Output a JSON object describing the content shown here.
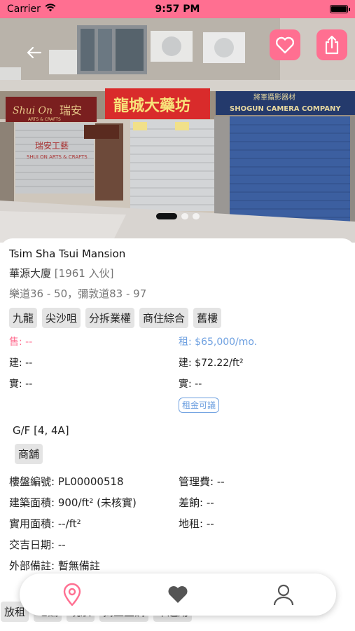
{
  "status_bar": {
    "carrier": "Carrier",
    "time": "9:57 PM"
  },
  "colors": {
    "accent": "#ff6f91",
    "rent_blue": "#6ea0e0",
    "tag_bg": "#e4e4e4"
  },
  "header": {
    "back_icon": "back-arrow-icon",
    "favorite_icon": "heart-outline-icon",
    "share_icon": "share-icon",
    "carousel_pages": 3,
    "carousel_active": 1
  },
  "photo_signs": {
    "shop1_en": "Shui On",
    "shop1_zh": "瑞安",
    "shop1_sub": "ARTS & CRAFTS",
    "shop1_shutter": "瑞安工藝",
    "shop1_shutter_en": "SHUI ON ARTS & CRAFTS",
    "shop2_zh": "龍城大藥坊",
    "shop3_zh": "將軍攝影器材",
    "shop3_en": "SHOGUN CAMERA COMPANY"
  },
  "property": {
    "name_en": "Tsim Sha Tsui Mansion",
    "name_zh": "華源大廈",
    "year": "[1961 入伙]",
    "address": "樂道36 - 50，彌敦道83 - 97",
    "tags": [
      "九龍",
      "尖沙咀",
      "分拆業權",
      "商住綜合",
      "舊樓"
    ]
  },
  "pricing": {
    "sale": "售: --",
    "rent": "租: $65,000/mo.",
    "sale_gross": "建: --",
    "rent_gross": "建: $72.22/ft²",
    "sale_net": "實: --",
    "rent_net": "實: --",
    "negotiable": "租金可議"
  },
  "unit": {
    "floor": "G/F [4, 4A]",
    "usage": "商舖"
  },
  "details": {
    "listing_no": "樓盤編號: PL00000518",
    "mgmt_fee": "管理費: --",
    "gross_area": "建築面積: 900/ft² (未核實)",
    "rates": "差餉: --",
    "net_area": "實用面積: --/ft²",
    "ground_rent": "地租: --",
    "handover": "交吉日期: --",
    "remarks": "外部備註: 暫無備註"
  },
  "bottom_tags": [
    "放租",
    "地舖",
    "現狀",
    "獨立主調",
    "千遞用"
  ],
  "tab_bar": {
    "items": [
      "map-pin-icon",
      "heart-icon",
      "person-icon"
    ],
    "active": 0
  }
}
